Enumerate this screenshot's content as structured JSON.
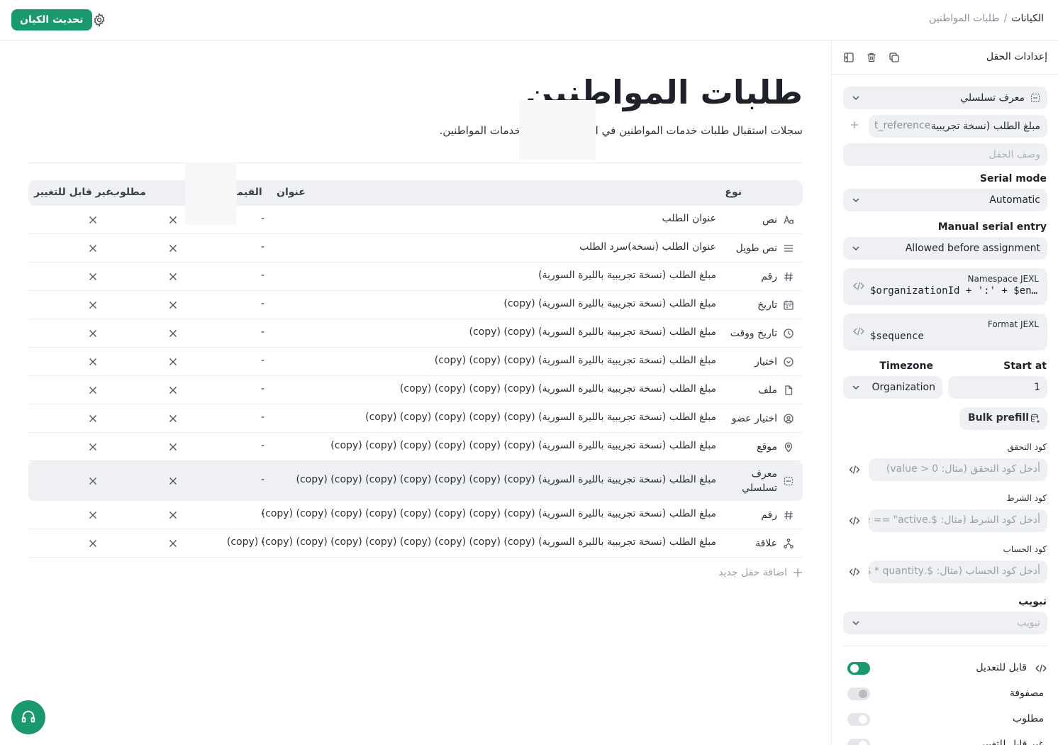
{
  "header": {
    "breadcrumb_root": "الكيانات",
    "breadcrumb_sep": "/",
    "breadcrumb_current": "طلبات المواطنين",
    "update_button": "تحديث الكيان",
    "accent": "#1a9a6c"
  },
  "entity": {
    "title": "طلبات المواطنين",
    "description": "سجلات استقبال طلبات خدمات المواطنين في المديرية الخيالية لخدمات المواطنين."
  },
  "table": {
    "headers": {
      "type": "نوع",
      "title": "عنوان",
      "value": "القيمة",
      "required": "مطلوب",
      "immutable": "غير قابل للتغيير"
    },
    "rows": [
      {
        "icon": "text-icon",
        "type": "نص",
        "title": "عنوان الطلب",
        "value": "-"
      },
      {
        "icon": "long-text-icon",
        "type": "نص طويل",
        "title": "عنوان الطلب (نسخة)سرد الطلب",
        "value": "-"
      },
      {
        "icon": "hash-icon",
        "type": "رقم",
        "title": "مبلغ الطلب (نسخة تجريبية بالليرة السورية)",
        "value": "-"
      },
      {
        "icon": "calendar-icon",
        "type": "تاريخ",
        "title": "مبلغ الطلب (نسخة تجريبية بالليرة السورية) (copy)",
        "value": "-"
      },
      {
        "icon": "clock-icon",
        "type": "تاريخ ووقت",
        "title": "مبلغ الطلب (نسخة تجريبية بالليرة السورية) (copy) (copy)",
        "value": "-"
      },
      {
        "icon": "select-icon",
        "type": "اختيار",
        "title": "مبلغ الطلب (نسخة تجريبية بالليرة السورية) (copy) (copy) (copy)",
        "value": "-"
      },
      {
        "icon": "file-icon",
        "type": "ملف",
        "title": "مبلغ الطلب (نسخة تجريبية بالليرة السورية) (copy) (copy) (copy) (copy)",
        "value": "-"
      },
      {
        "icon": "member-icon",
        "type": "اختيار عضو",
        "title": "مبلغ الطلب (نسخة تجريبية بالليرة السورية) (copy) (copy) (copy) (copy) (copy)",
        "value": "-"
      },
      {
        "icon": "location-icon",
        "type": "موقع",
        "title": "مبلغ الطلب (نسخة تجريبية بالليرة السورية) (copy) (copy) (copy) (copy) (copy) (copy)",
        "value": "-"
      },
      {
        "icon": "serial-icon",
        "type": "معرف تسلسلي",
        "title": "مبلغ الطلب (نسخة تجريبية بالليرة السورية) (copy) (copy) (copy) (copy) (copy) (copy) (copy)",
        "value": "-",
        "selected": true
      },
      {
        "icon": "hash-icon",
        "type": "رقم",
        "title": "مبلغ الطلب (نسخة تجريبية بالليرة السورية) (copy) (copy) (copy) (copy) (copy) (copy) (copy) (copy)",
        "value": "-"
      },
      {
        "icon": "relation-icon",
        "type": "علاقة",
        "title": "مبلغ الطلب (نسخة تجريبية بالليرة السورية) (copy) (copy) (copy) (copy) (copy) (copy) (copy) (copy) (copy)",
        "value": "-"
      }
    ],
    "add_field": "اضافة حقل جديد"
  },
  "panel": {
    "title": "إعدادات الحقل",
    "field_type": "معرف تسلسلي",
    "field_label_value": "مبلغ الطلب (نسخة تجريبية",
    "field_key_value": "t_reference",
    "description_placeholder": "وصف الحقل",
    "serial_mode_label": "Serial mode",
    "serial_mode_value": "Automatic",
    "manual_entry_label": "Manual serial entry",
    "manual_entry_value": "Allowed before assignment",
    "namespace_label": "Namespace JEXL",
    "namespace_value": "$organizationId + ':' + $en…",
    "format_label": "Format JEXL",
    "format_value": "$sequence",
    "start_at_label": "Start at",
    "start_at_value": "1",
    "timezone_label": "Timezone",
    "timezone_value": "Organization",
    "bulk_prefill": "Bulk prefill",
    "validation_label": "كود التحقق",
    "validation_placeholder": "أدخل كود التحقق (مثال: value > 0)",
    "condition_label": "كود الشرط",
    "condition_placeholder": "أدخل كود الشرط (مثال: $.type == \"active\"",
    "calc_label": "كود الحساب",
    "calc_placeholder": "أدخل كود الحساب (مثال: $.quantity * $",
    "tab_label": "تبويب",
    "tab_placeholder": "تبويب",
    "toggles": [
      {
        "label": "قابل للتعديل",
        "state": "on"
      },
      {
        "label": "مصفوفة",
        "state": "disabled"
      },
      {
        "label": "مطلوب",
        "state": "off"
      },
      {
        "label": "غير قابل للتغيير",
        "state": "off"
      }
    ]
  }
}
